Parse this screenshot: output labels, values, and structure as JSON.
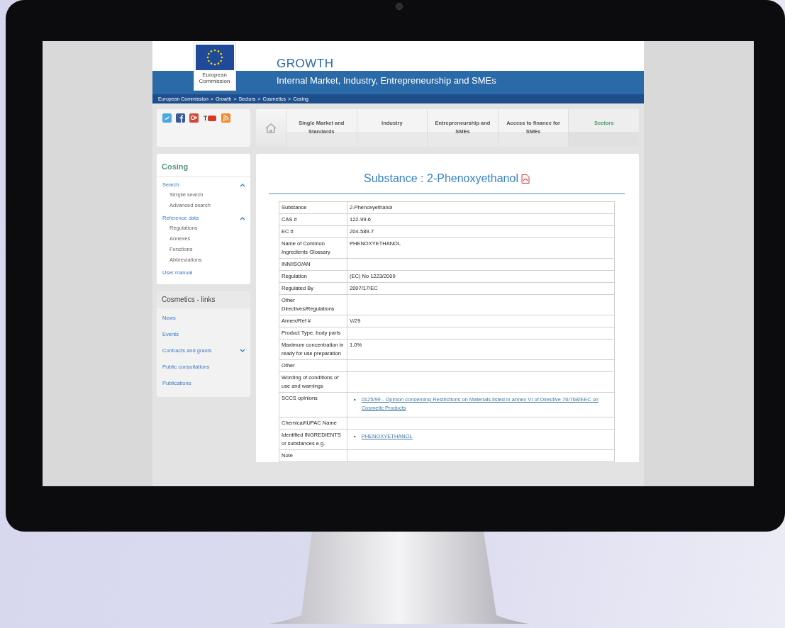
{
  "header": {
    "logo_text": "European Commission",
    "title": "GROWTH",
    "subtitle": "Internal Market, Industry, Entrepreneurship and SMEs"
  },
  "breadcrumb": {
    "separator": ">",
    "items": [
      "European Commission",
      "Growth",
      "Sectors",
      "Cosmetics",
      "Cosing"
    ]
  },
  "nav": [
    {
      "label": "Single Market and Standards",
      "selected": false
    },
    {
      "label": "Industry",
      "selected": false
    },
    {
      "label": "Entrepreneurship and SMEs",
      "selected": false
    },
    {
      "label": "Access to finance for SMEs",
      "selected": false
    },
    {
      "label": "Sectors",
      "selected": true
    }
  ],
  "sidebar": {
    "title": "Cosing",
    "items": [
      {
        "label": "Search",
        "kind": "group",
        "expanded": true,
        "children": [
          "Simple search",
          "Advanced search"
        ]
      },
      {
        "label": "Reference data",
        "kind": "group",
        "expanded": true,
        "children": [
          "Regulations",
          "Annexes",
          "Functions",
          "Abbreviations"
        ]
      },
      {
        "label": "User manual",
        "kind": "link"
      }
    ]
  },
  "links_box": {
    "title": "Cosmetics - links",
    "items": [
      {
        "label": "News",
        "kind": "link"
      },
      {
        "label": "Events",
        "kind": "link"
      },
      {
        "label": "Contracts and grants",
        "kind": "group",
        "expanded": false
      },
      {
        "label": "Public consultations",
        "kind": "link"
      },
      {
        "label": "Publications",
        "kind": "link"
      }
    ]
  },
  "content": {
    "title": "Substance : 2-Phenoxyethanol",
    "rows": [
      {
        "label": "Substance",
        "kind": "text",
        "value": "2-Phenoxyethanol"
      },
      {
        "label": "CAS #",
        "kind": "text",
        "value": "122-99-6"
      },
      {
        "label": "EC #",
        "kind": "text",
        "value": "204-589-7"
      },
      {
        "label": "Name of Common Ingredients Glossary",
        "kind": "text",
        "value": "PHENOXYETHANOL"
      },
      {
        "label": "INN/ISO/AN",
        "kind": "text"
      },
      {
        "label": "Regulation",
        "kind": "text",
        "value": "(EC) No 1223/2009"
      },
      {
        "label": "Regulated By",
        "kind": "text",
        "value": "2007/17/EC"
      },
      {
        "label": "Other Directives/Regulations",
        "kind": "text"
      },
      {
        "label": "Annex/Ref #",
        "kind": "text",
        "value": "V/29"
      },
      {
        "label": "Product Type, body parts",
        "kind": "text"
      },
      {
        "label": "Maximum concentration in ready for use preparation",
        "kind": "text",
        "value": "1.0%"
      },
      {
        "label": "Other",
        "kind": "text"
      },
      {
        "label": "Wording of conditions of use and warnings",
        "kind": "text"
      },
      {
        "label": "SCCS opinions",
        "kind": "links",
        "bullet": "•",
        "links": [
          "0125/99 - Opinion concerning Restrictions on Materials listed in annex VI of Directive 76/768/EEC on Cosmetic Products"
        ]
      },
      {
        "label": "Chemical/IUPAC Name",
        "kind": "text"
      },
      {
        "label": "Identified INGREDIENTS or substances e.g.",
        "kind": "links",
        "bullet": "•",
        "links": [
          "PHENOXYETHANOL"
        ]
      },
      {
        "label": "Note",
        "kind": "text"
      }
    ]
  }
}
